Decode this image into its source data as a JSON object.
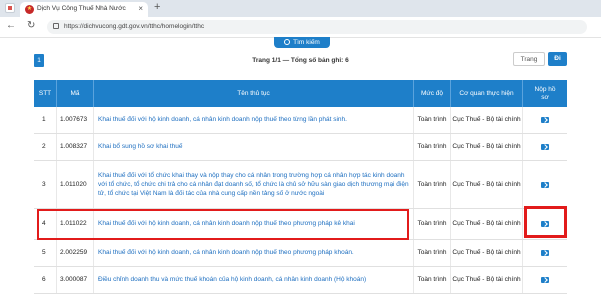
{
  "browser": {
    "tab_title": "Dịch Vụ Công Thuế Nhà Nước",
    "url": "https://dichvucong.gdt.gov.vn/tthc/homelogin/tthc"
  },
  "search": {
    "label": "Tìm kiếm"
  },
  "pagination": {
    "current_page": "1",
    "info": "Trang 1/1 — Tổng số bản ghi: 6",
    "goto_placeholder": "Trang",
    "goto_button": "Đi"
  },
  "table": {
    "headers": {
      "stt": "STT",
      "code": "Mã",
      "name": "Tên thủ tục",
      "level": "Mức độ",
      "agency": "Cơ quan thực hiện",
      "submit": "Nộp hồ sơ"
    },
    "rows": [
      {
        "stt": "1",
        "code": "1.007673",
        "name": "Khai thuế đối với hộ kinh doanh, cá nhân kinh doanh nộp thuế theo từng lần phát sinh.",
        "level": "Toàn trình",
        "agency": "Cục Thuế - Bộ tài chính"
      },
      {
        "stt": "2",
        "code": "1.008327",
        "name": "Khai bổ sung hồ sơ khai thuế",
        "level": "Toàn trình",
        "agency": "Cục Thuế - Bộ tài chính"
      },
      {
        "stt": "3",
        "code": "1.011020",
        "name": "Khai thuế đối với tổ chức khai thay và nộp thay cho cá nhân trong trường hợp cá nhân hợp tác kinh doanh với tổ chức, tổ chức chi trả cho cá nhân đạt doanh số, tổ chức là chủ sở hữu sàn giao dịch thương mại điện tử, tổ chức tại Việt Nam là đối tác của nhà cung cấp nền tảng số ở nước ngoài",
        "level": "Toàn trình",
        "agency": "Cục Thuế - Bộ tài chính"
      },
      {
        "stt": "4",
        "code": "1.011022",
        "name": "Khai thuế đối với hộ kinh doanh, cá nhân kinh doanh nộp thuế theo phương pháp kê khai",
        "level": "Toàn trình",
        "agency": "Cục Thuế - Bộ tài chính"
      },
      {
        "stt": "5",
        "code": "2.002259",
        "name": "Khai thuế đối với hộ kinh doanh, cá nhân kinh doanh nộp thuế theo phương pháp khoán.",
        "level": "Toàn trình",
        "agency": "Cục Thuế - Bộ tài chính"
      },
      {
        "stt": "6",
        "code": "3.000087",
        "name": "Điều chỉnh doanh thu và mức thuế khoán của hộ kinh doanh, cá nhân kinh doanh (Hộ khoán)",
        "level": "Toàn trình",
        "agency": "Cục Thuế - Bộ tài chính"
      }
    ]
  },
  "colors": {
    "primary": "#1e7fc9",
    "highlight": "#e21b1b",
    "link": "#1e6fc0"
  }
}
